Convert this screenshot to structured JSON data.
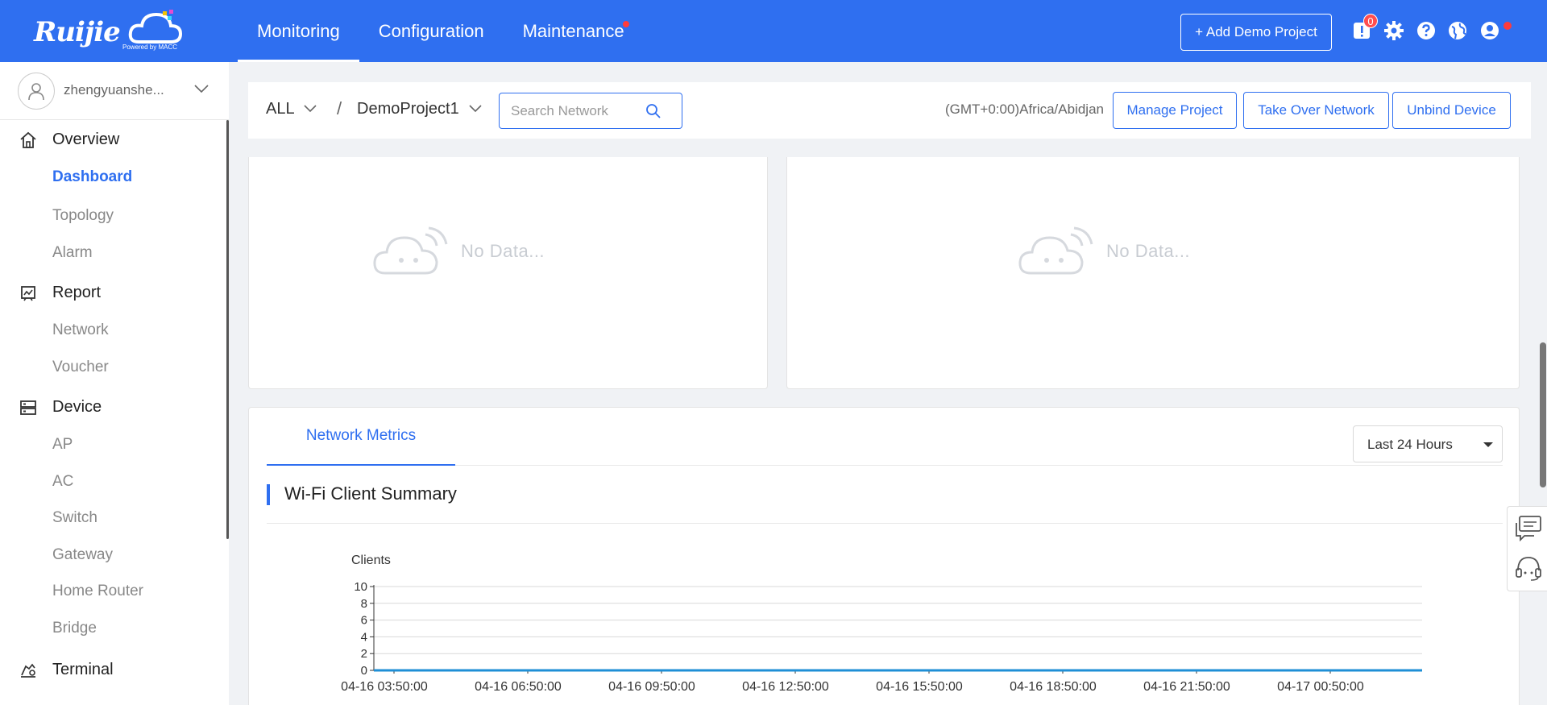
{
  "app": {
    "logo_text": "Ruijie",
    "logo_sub": "Powered by MACC"
  },
  "topnav": {
    "items": [
      {
        "label": "Monitoring",
        "active": true,
        "dot": false
      },
      {
        "label": "Configuration",
        "active": false,
        "dot": false
      },
      {
        "label": "Maintenance",
        "active": false,
        "dot": true
      }
    ],
    "add_demo_label": "+ Add Demo Project",
    "alarm_badge": "0",
    "icons": [
      "alert-icon",
      "gear-icon",
      "help-icon",
      "globe-icon",
      "user-icon"
    ]
  },
  "sidebar": {
    "user_name": "zhengyuanshe...",
    "groups": [
      {
        "label": "Overview",
        "icon": "home-icon",
        "items": [
          {
            "label": "Dashboard",
            "active": true
          },
          {
            "label": "Topology",
            "active": false
          },
          {
            "label": "Alarm",
            "active": false
          }
        ]
      },
      {
        "label": "Report",
        "icon": "report-icon",
        "items": [
          {
            "label": "Network",
            "active": false
          },
          {
            "label": "Voucher",
            "active": false
          }
        ]
      },
      {
        "label": "Device",
        "icon": "device-icon",
        "items": [
          {
            "label": "AP",
            "active": false
          },
          {
            "label": "AC",
            "active": false
          },
          {
            "label": "Switch",
            "active": false
          },
          {
            "label": "Gateway",
            "active": false
          },
          {
            "label": "Home Router",
            "active": false
          },
          {
            "label": "Bridge",
            "active": false
          }
        ]
      },
      {
        "label": "Terminal",
        "icon": "terminal-icon",
        "items": []
      }
    ]
  },
  "filter": {
    "scope": "ALL",
    "separator": "/",
    "project": "DemoProject1",
    "search_placeholder": "Search Network",
    "timezone": "(GMT+0:00)Africa/Abidjan",
    "manage_project": "Manage Project",
    "take_over": "Take Over Network",
    "unbind_device": "Unbind Device"
  },
  "empty_panels": {
    "left_text": "No Data...",
    "right_text": "No Data..."
  },
  "metrics": {
    "tab_label": "Network Metrics",
    "range_label": "Last 24 Hours",
    "section_title": "Wi-Fi Client Summary"
  },
  "chart_data": {
    "type": "line",
    "title": "",
    "ylabel": "Clients",
    "xlabel": "",
    "ylim": [
      0,
      10
    ],
    "yticks": [
      0,
      2,
      4,
      6,
      8,
      10
    ],
    "x_ticks": [
      "04-16 03:50:00",
      "04-16 06:50:00",
      "04-16 09:50:00",
      "04-16 12:50:00",
      "04-16 15:50:00",
      "04-16 18:50:00",
      "04-16 21:50:00",
      "04-17 00:50:00"
    ],
    "series": [
      {
        "values": [
          0,
          0,
          0,
          0,
          0,
          0,
          0,
          0,
          0
        ],
        "color": "#1f8fd6"
      }
    ],
    "grid": true
  },
  "colors": {
    "accent": "#2f6ff0",
    "alert": "#ff3b3b"
  }
}
